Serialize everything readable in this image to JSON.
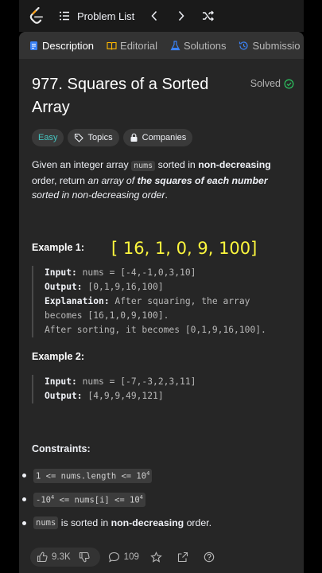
{
  "topbar": {
    "problem_list": "Problem List",
    "logo_icon": "leetcode-logo",
    "prev_icon": "chevron-left-icon",
    "next_icon": "chevron-right-icon",
    "shuffle_icon": "shuffle-icon"
  },
  "tabs": [
    {
      "label": "Description",
      "icon": "description-icon",
      "active": true
    },
    {
      "label": "Editorial",
      "icon": "book-icon",
      "active": false
    },
    {
      "label": "Solutions",
      "icon": "flask-icon",
      "active": false
    },
    {
      "label": "Submissio",
      "icon": "history-icon",
      "active": false
    }
  ],
  "problem": {
    "title": "977. Squares of a Sorted Array",
    "status": "Solved",
    "difficulty": "Easy",
    "topics_label": "Topics",
    "companies_label": "Companies",
    "desc_1": "Given an integer array ",
    "desc_code": "nums",
    "desc_2": " sorted in ",
    "desc_bold": "non-decreasing",
    "desc_3": " order, return ",
    "desc_italic_1": "an array of ",
    "desc_bold_italic": "the squares of each number",
    "desc_italic_2": " sorted in non-decreasing order",
    "desc_4": "."
  },
  "overlay_text": "[ 16, 1, 0, 9, 100]",
  "examples": [
    {
      "heading": "Example 1:",
      "input_label": "Input:",
      "input": " nums = [-4,-1,0,3,10]",
      "output_label": "Output:",
      "output": " [0,1,9,16,100]",
      "explanation_label": "Explanation:",
      "explanation_1": " After squaring, the array",
      "explanation_2": "becomes [16,1,0,9,100].",
      "explanation_3": "After sorting, it becomes [0,1,9,16,100]."
    },
    {
      "heading": "Example 2:",
      "input_label": "Input:",
      "input": " nums = [-7,-3,2,3,11]",
      "output_label": "Output:",
      "output": " [4,9,9,49,121]"
    }
  ],
  "constraints": {
    "heading": "Constraints:",
    "c1_a": "1 <= nums.length <= 10",
    "c1_sup": "4",
    "c2_a": "-10",
    "c2_sup1": "4",
    "c2_b": " <= nums[i] <= 10",
    "c2_sup2": "4",
    "c3_code": "nums",
    "c3_text1": " is sorted in ",
    "c3_bold": "non-decreasing",
    "c3_text2": " order."
  },
  "bottom": {
    "likes": "9.3K",
    "comments": "109"
  },
  "colors": {
    "easy": "#46c6c2",
    "solved": "#2cbb5d",
    "overlay": "#fdf73d",
    "accent_blue": "#3b82f6"
  }
}
